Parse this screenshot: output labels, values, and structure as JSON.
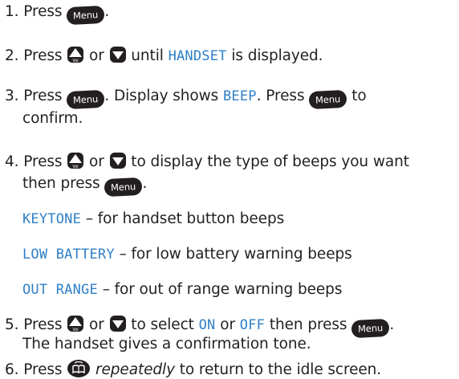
{
  "steps": {
    "s1": {
      "num": "1.",
      "press": "Press",
      "end": "."
    },
    "s2": {
      "num": "2.",
      "press": "Press",
      "or": "or",
      "until": "until",
      "lcd": "HANDSET",
      "rest": "is displayed."
    },
    "s3": {
      "num": "3.",
      "press": "Press",
      "mid": ". Display shows",
      "lcd": "BEEP",
      "mid2": ". Press",
      "to": "to",
      "line2": "confirm."
    },
    "s4": {
      "num": "4.",
      "press": "Press",
      "or": "or",
      "rest": "to display the type of beeps you want",
      "line2": "then press",
      "end": "."
    },
    "s5": {
      "num": "5.",
      "press": "Press",
      "or": "or",
      "mid": "to select",
      "lcd_on": "ON",
      "or2": "or",
      "lcd_off": "OFF",
      "mid2": "then press",
      "end": ".",
      "line2": "The handset gives a confirmation tone."
    },
    "s6": {
      "num": "6.",
      "press": "Press",
      "italic": "repeatedly",
      "rest": "to return to the idle screen."
    }
  },
  "options": [
    {
      "lcd": "KEYTONE",
      "desc": "– for handset button beeps"
    },
    {
      "lcd": "LOW BATTERY",
      "desc": "– for low battery warning beeps"
    },
    {
      "lcd": "OUT RANGE",
      "desc": "– for out of range warning beeps"
    }
  ],
  "buttons": {
    "menu_label": "Menu",
    "vol_label": "Vol"
  },
  "icons": {
    "menu": "menu-button-icon",
    "up": "up-vol-button-icon",
    "down": "down-button-icon",
    "end": "phonebook-button-icon"
  },
  "colors": {
    "text": "#231f20",
    "lcd": "#2f7fc6",
    "button": "#231f20"
  }
}
